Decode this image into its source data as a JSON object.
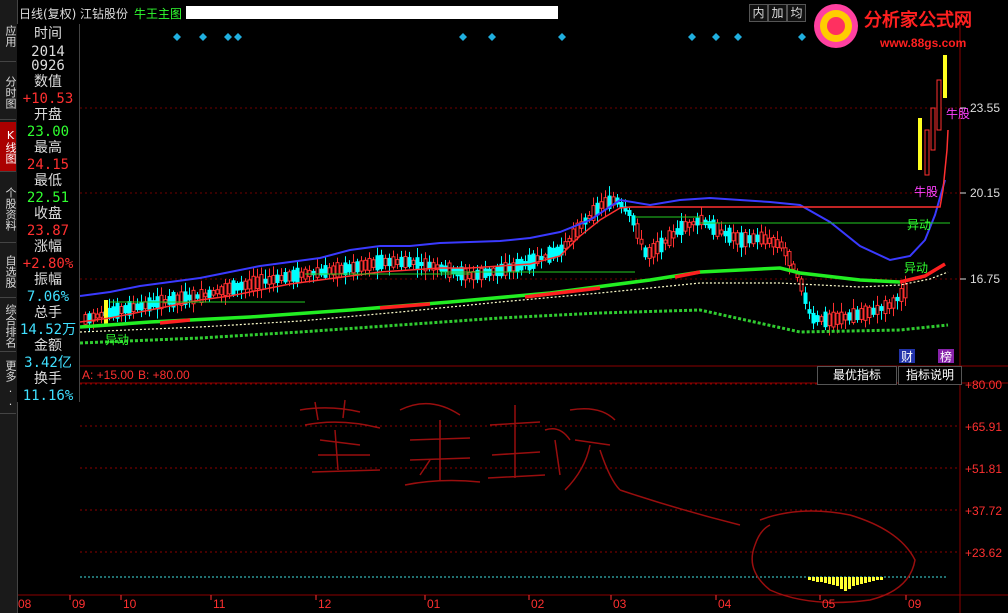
{
  "app": {
    "period": "日线(复权)",
    "stock_name": "江钻股份",
    "main_indicator": "牛王主图",
    "buttons": [
      "内",
      "加",
      "均"
    ],
    "logo_text": "分析家公式网",
    "logo_url": "www.88gs.com"
  },
  "sidebar": [
    {
      "label": "应用",
      "active": false
    },
    {
      "label": "分时图",
      "active": false
    },
    {
      "label": "K线图",
      "active": true
    },
    {
      "label": "个股资料",
      "active": false
    },
    {
      "label": "自选股",
      "active": false
    },
    {
      "label": "综合排名",
      "active": false
    },
    {
      "label": "更多..",
      "active": false
    }
  ],
  "info": {
    "time_label": "时间",
    "date_year": "2014",
    "date_md": "0926",
    "value_label": "数值",
    "value": "+10.53",
    "open_label": "开盘",
    "open": "23.00",
    "high_label": "最高",
    "high": "24.15",
    "low_label": "最低",
    "low": "22.51",
    "close_label": "收盘",
    "close": "23.87",
    "change_label": "涨幅",
    "change": "+2.80%",
    "amplitude_label": "振幅",
    "amplitude": "7.06%",
    "volume_label": "总手",
    "volume": "14.52万",
    "amount_label": "金额",
    "amount": "3.42亿",
    "turnover_label": "换手",
    "turnover": "11.16%"
  },
  "main_chart": {
    "price_ticks": [
      "23.55",
      "20.15",
      "16.75"
    ],
    "labels": {
      "yidong": "异动",
      "niugu": "牛股",
      "niu": "牛股",
      "cai": "财",
      "bang": "榜"
    }
  },
  "sub_chart": {
    "legend_a": "A: +15.00",
    "legend_b": "B: +80.00",
    "best_indicator_btn": "最优指标",
    "indicator_help_btn": "指标说明",
    "ticks": [
      "+80.00",
      "+65.91",
      "+51.81",
      "+37.72",
      "+23.62"
    ]
  },
  "x_axis": [
    "08",
    "09",
    "10",
    "11",
    "12",
    "01",
    "02",
    "03",
    "04",
    "05",
    "09"
  ],
  "colors": {
    "up": "#ff3030",
    "down": "#00ffff",
    "grid": "#8b0000",
    "upper_band": "#4040ff"
  }
}
